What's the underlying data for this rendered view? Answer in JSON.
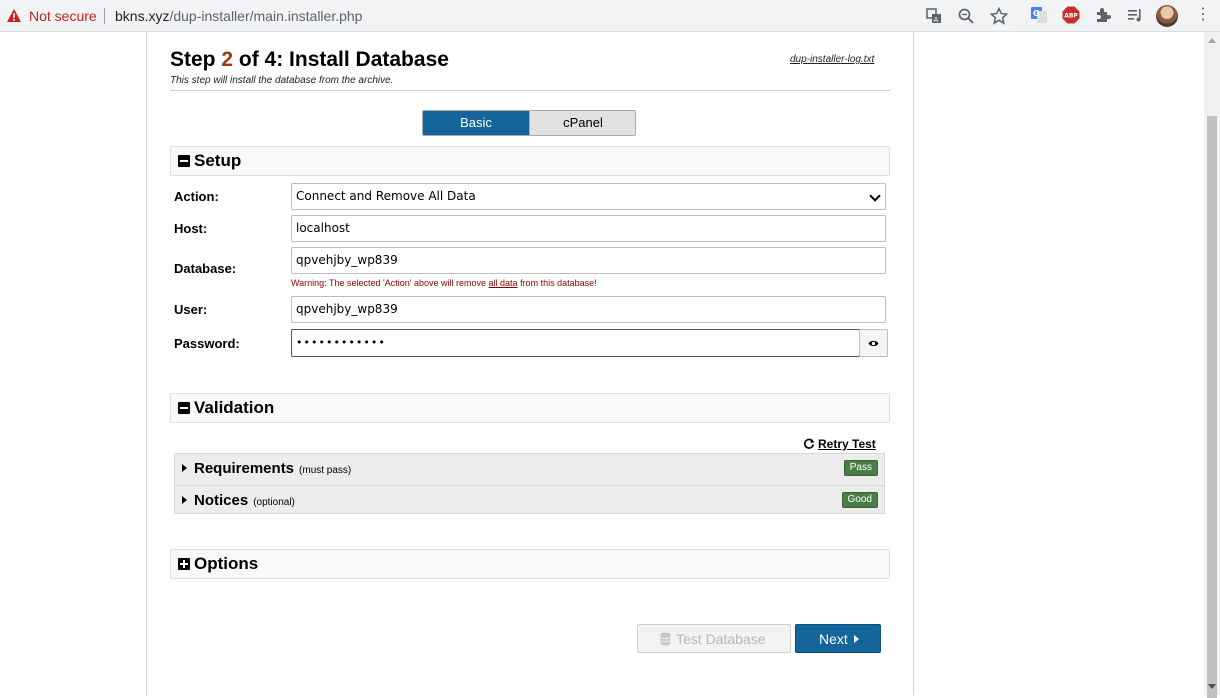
{
  "browser": {
    "security_label": "Not secure",
    "url_host": "bkns.xyz",
    "url_path": "/dup-installer/main.installer.php"
  },
  "header": {
    "step_prefix": "Step ",
    "step_number": "2",
    "step_suffix": " of 4: Install Database",
    "subtitle": "This step will install the database from the archive.",
    "log_link": "dup-installer-log.txt"
  },
  "tabs": {
    "basic": "Basic",
    "cpanel": "cPanel",
    "active": "Basic"
  },
  "setup": {
    "title": "Setup",
    "action_label": "Action:",
    "action_value": "Connect and Remove All Data",
    "host_label": "Host:",
    "host_value": "localhost",
    "database_label": "Database:",
    "database_value": "qpvehjby_wp839",
    "warning_prefix": "Warning: The selected 'Action' above will remove ",
    "warning_link": "all data",
    "warning_suffix": " from this database!",
    "user_label": "User:",
    "user_value": "qpvehjby_wp839",
    "password_label": "Password:",
    "password_value": "••••••••••••"
  },
  "validation": {
    "title": "Validation",
    "retry_label": "Retry Test",
    "requirements_label": "Requirements",
    "requirements_note": "(must pass)",
    "requirements_status": "Pass",
    "notices_label": "Notices",
    "notices_note": "(optional)",
    "notices_status": "Good"
  },
  "options": {
    "title": "Options"
  },
  "footer": {
    "test_button": "Test Database",
    "next_button": "Next"
  },
  "colors": {
    "primary_blue": "#13659c",
    "step_number": "#9c3d10",
    "badge_green": "#4b7d46",
    "warning_red": "#8b0000"
  }
}
